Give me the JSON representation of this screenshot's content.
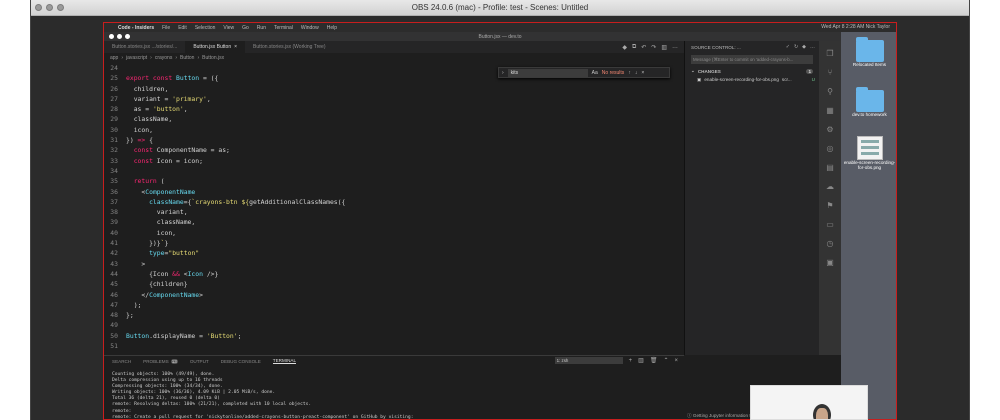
{
  "obs": {
    "title": "OBS 24.0.6 (mac) - Profile: test - Scenes: Untitled"
  },
  "menubar": {
    "app_name": "Code - Insiders",
    "items": [
      "File",
      "Edit",
      "Selection",
      "View",
      "Go",
      "Run",
      "Terminal",
      "Window",
      "Help"
    ],
    "clock": "Wed Apr 8  2:28 AM   Nick Taylor"
  },
  "vscode": {
    "window_title": "Button.jsx — dev.to",
    "tabs": [
      {
        "label": "Button.stories.jsx .../stories/..."
      },
      {
        "label": "Button.jsx  Button"
      },
      {
        "label": "Button.stories.jsx (Working Tree)"
      }
    ],
    "breadcrumb": [
      "app",
      "javascript",
      "crayons",
      "Button",
      "Button.jsx"
    ],
    "find": {
      "query": "kits",
      "result": "No results"
    },
    "code_lines": [
      {
        "n": "24",
        "parts": [
          {
            "t": "plain",
            "v": ""
          }
        ]
      },
      {
        "n": "25",
        "parts": [
          {
            "t": "kw",
            "v": "export const "
          },
          {
            "t": "var",
            "v": "Button"
          },
          {
            "t": "plain",
            "v": " = ({"
          }
        ]
      },
      {
        "n": "26",
        "parts": [
          {
            "t": "plain",
            "v": "  children,"
          }
        ]
      },
      {
        "n": "27",
        "parts": [
          {
            "t": "plain",
            "v": "  variant = "
          },
          {
            "t": "str",
            "v": "'primary'"
          },
          {
            "t": "plain",
            "v": ","
          }
        ]
      },
      {
        "n": "28",
        "parts": [
          {
            "t": "plain",
            "v": "  as = "
          },
          {
            "t": "str",
            "v": "'button'"
          },
          {
            "t": "plain",
            "v": ","
          }
        ]
      },
      {
        "n": "29",
        "parts": [
          {
            "t": "plain",
            "v": "  className,"
          }
        ]
      },
      {
        "n": "30",
        "parts": [
          {
            "t": "plain",
            "v": "  icon,"
          }
        ]
      },
      {
        "n": "31",
        "parts": [
          {
            "t": "plain",
            "v": "}) "
          },
          {
            "t": "kw",
            "v": "=>"
          },
          {
            "t": "plain",
            "v": " {"
          }
        ]
      },
      {
        "n": "32",
        "parts": [
          {
            "t": "kw",
            "v": "  const "
          },
          {
            "t": "plain",
            "v": "ComponentName = as;"
          }
        ]
      },
      {
        "n": "33",
        "parts": [
          {
            "t": "kw",
            "v": "  const "
          },
          {
            "t": "plain",
            "v": "Icon = icon;"
          }
        ]
      },
      {
        "n": "34",
        "parts": [
          {
            "t": "plain",
            "v": ""
          }
        ]
      },
      {
        "n": "35",
        "parts": [
          {
            "t": "kw",
            "v": "  return "
          },
          {
            "t": "plain",
            "v": "("
          }
        ]
      },
      {
        "n": "36",
        "parts": [
          {
            "t": "plain",
            "v": "    <"
          },
          {
            "t": "tag",
            "v": "ComponentName"
          }
        ]
      },
      {
        "n": "37",
        "parts": [
          {
            "t": "var",
            "v": "      className"
          },
          {
            "t": "plain",
            "v": "={"
          },
          {
            "t": "str",
            "v": "`crayons-btn ${"
          },
          {
            "t": "plain",
            "v": "getAdditionalClassNames({"
          }
        ]
      },
      {
        "n": "38",
        "parts": [
          {
            "t": "plain",
            "v": "        variant,"
          }
        ]
      },
      {
        "n": "39",
        "parts": [
          {
            "t": "plain",
            "v": "        className,"
          }
        ]
      },
      {
        "n": "40",
        "parts": [
          {
            "t": "plain",
            "v": "        icon,"
          }
        ]
      },
      {
        "n": "41",
        "parts": [
          {
            "t": "plain",
            "v": "      })}"
          },
          {
            "t": "str",
            "v": "`"
          },
          {
            "t": "plain",
            "v": "}"
          }
        ]
      },
      {
        "n": "42",
        "parts": [
          {
            "t": "var",
            "v": "      type"
          },
          {
            "t": "plain",
            "v": "="
          },
          {
            "t": "str",
            "v": "\"button\""
          }
        ]
      },
      {
        "n": "43",
        "parts": [
          {
            "t": "plain",
            "v": "    >"
          }
        ]
      },
      {
        "n": "44",
        "parts": [
          {
            "t": "plain",
            "v": "      {Icon "
          },
          {
            "t": "kw",
            "v": "&&"
          },
          {
            "t": "plain",
            "v": " <"
          },
          {
            "t": "tag",
            "v": "Icon"
          },
          {
            "t": "plain",
            "v": " />}"
          }
        ]
      },
      {
        "n": "45",
        "parts": [
          {
            "t": "plain",
            "v": "      {children}"
          }
        ]
      },
      {
        "n": "46",
        "parts": [
          {
            "t": "plain",
            "v": "    </"
          },
          {
            "t": "tag",
            "v": "ComponentName"
          },
          {
            "t": "plain",
            "v": ">"
          }
        ]
      },
      {
        "n": "47",
        "parts": [
          {
            "t": "plain",
            "v": "  );"
          }
        ]
      },
      {
        "n": "48",
        "parts": [
          {
            "t": "plain",
            "v": "};"
          }
        ]
      },
      {
        "n": "49",
        "parts": [
          {
            "t": "plain",
            "v": ""
          }
        ]
      },
      {
        "n": "50",
        "parts": [
          {
            "t": "var",
            "v": "Button"
          },
          {
            "t": "plain",
            "v": ".displayName = "
          },
          {
            "t": "str",
            "v": "'Button'"
          },
          {
            "t": "plain",
            "v": ";"
          }
        ]
      },
      {
        "n": "51",
        "parts": [
          {
            "t": "plain",
            "v": ""
          }
        ]
      }
    ]
  },
  "source_control": {
    "header": "SOURCE CONTROL: ...",
    "message_placeholder": "Message (⌘Enter to commit on 'added-crayons-b...",
    "changes_label": "CHANGES",
    "changes_count": "1",
    "file": {
      "name": "enable-screen-recording-for-obs.png",
      "path": "scr...",
      "status": "U"
    }
  },
  "desktop": {
    "items": [
      {
        "label": "Relocated Items",
        "kind": "folder"
      },
      {
        "label": "dev.to homework",
        "kind": "folder"
      },
      {
        "label": "enable-screen-recording-for-obs.png",
        "kind": "doc"
      }
    ]
  },
  "panel": {
    "tabs": [
      {
        "label": "SEARCH"
      },
      {
        "label": "PROBLEMS",
        "badge": "13"
      },
      {
        "label": "OUTPUT"
      },
      {
        "label": "DEBUG CONSOLE"
      },
      {
        "label": "TERMINAL"
      }
    ],
    "terminal_select": "1: zsh",
    "terminal_lines": [
      "Counting objects: 100% (49/49), done.",
      "Delta compression using up to 16 threads",
      "Compressing objects: 100% (34/34), done.",
      "Writing objects: 100% (36/36), 4.09 KiB | 2.05 MiB/s, done.",
      "Total 36 (delta 21), reused 0 (delta 0)",
      "remote: Resolving deltas: 100% (21/21), completed with 10 local objects.",
      "remote:",
      "remote: Create a pull request for 'nickytonline/added-crayons-button-preact-component' on GitHub by visiting:"
    ]
  },
  "notification": {
    "text": "Getting Jupyter information to file..."
  }
}
